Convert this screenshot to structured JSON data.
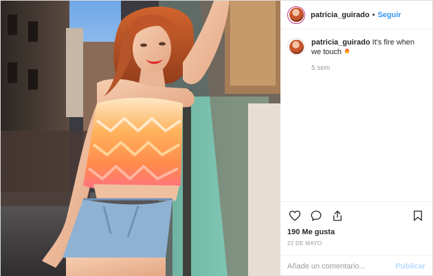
{
  "post": {
    "username": "patricia_guirado",
    "separator": "•",
    "follow_label": "Seguir",
    "caption": {
      "username": "patricia_guirado",
      "text": "It's fire when we touch",
      "emoji_icon": "fire-icon",
      "time": "5 sem"
    },
    "likes": "190 Me gusta",
    "date": "22 DE MAYO",
    "comment_placeholder": "Añade un comentario...",
    "publish_label": "Publicar",
    "icons": [
      "heart-icon",
      "comment-icon",
      "share-icon",
      "bookmark-icon"
    ],
    "colors": {
      "link": "#3897f0",
      "publish_disabled": "#b3dbff",
      "muted": "#999999",
      "text": "#262626",
      "avatar_ring": "#c13584"
    }
  }
}
